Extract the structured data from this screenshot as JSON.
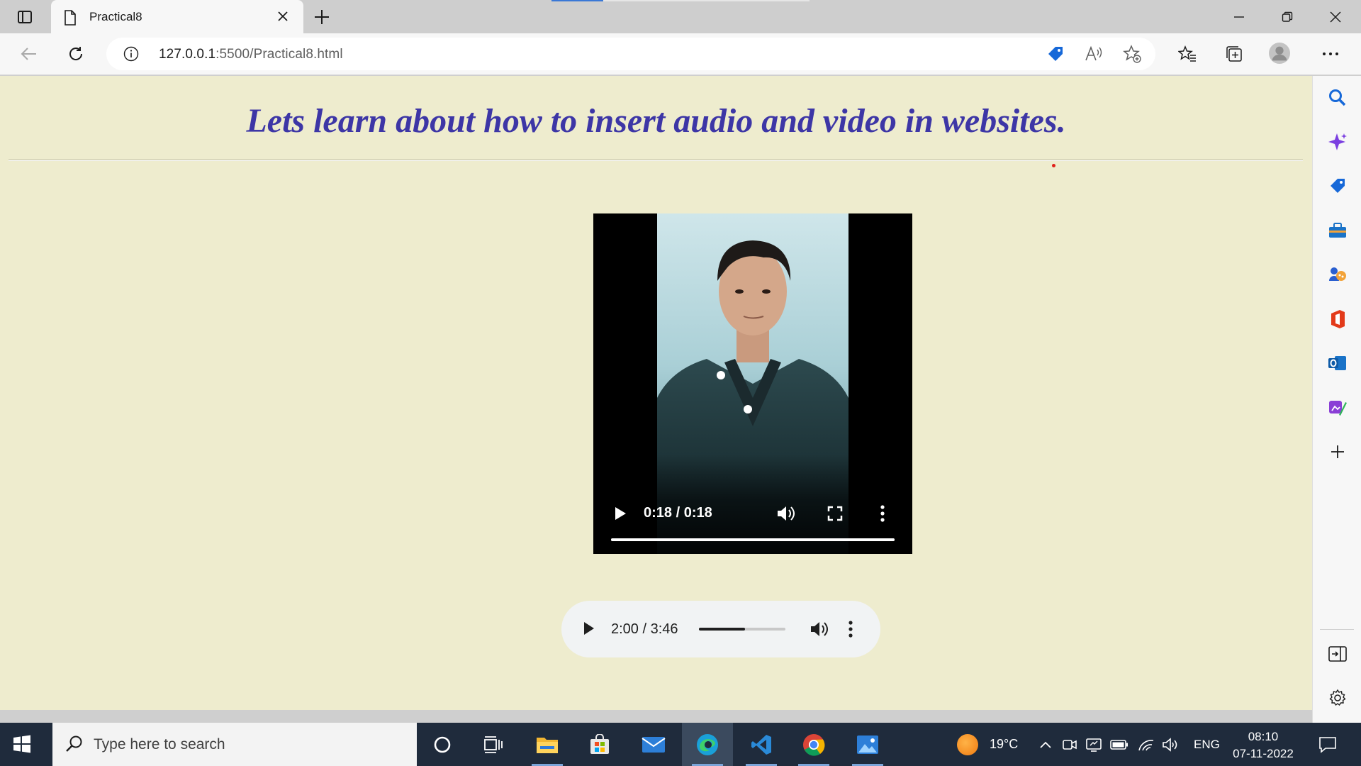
{
  "browser": {
    "tab_title": "Practical8",
    "url_host": "127.0.0.1",
    "url_rest": ":5500/Practical8.html",
    "loading_progress_fraction": 0.2
  },
  "page": {
    "heading": "Lets learn about how to insert audio and video in websites.",
    "video": {
      "time": "0:18 / 0:18",
      "progress_fraction": 1.0
    },
    "audio": {
      "time": "2:00 / 3:46",
      "progress_fraction": 0.53
    }
  },
  "sidebar": {
    "icons": [
      "search-icon",
      "copilot-icon",
      "shopping-tag-icon",
      "tools-icon",
      "games-icon",
      "office-icon",
      "outlook-icon",
      "designer-icon",
      "add-icon",
      "split-screen-icon",
      "settings-icon"
    ]
  },
  "taskbar": {
    "search_placeholder": "Type here to search",
    "temperature": "19°C",
    "language": "ENG",
    "time": "08:10",
    "date": "07-11-2022"
  },
  "colors": {
    "page_background": "#eeecce",
    "heading": "#3d36a6",
    "taskbar": "#1f2b3c"
  }
}
